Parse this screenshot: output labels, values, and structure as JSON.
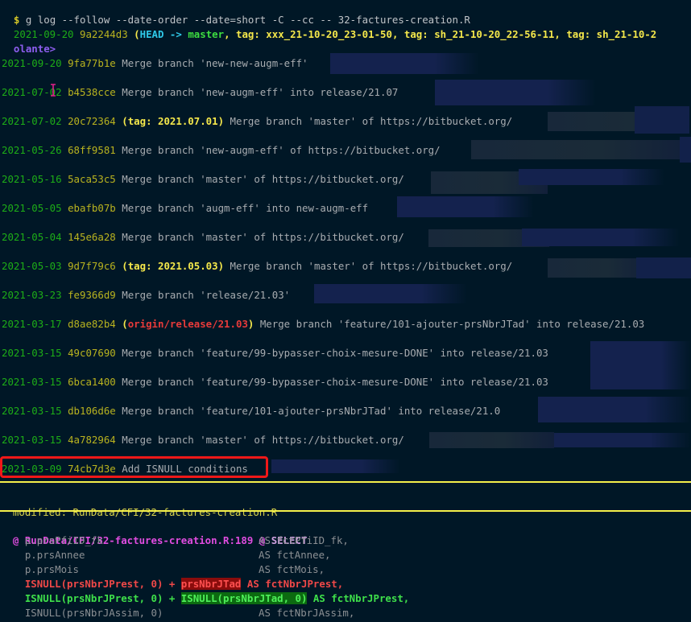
{
  "terminal": {
    "prompt_symbol": "$",
    "command": " g log --follow --date-order --date=short -C --cc -- 32-factures-creation.R",
    "head_commit": {
      "date": "2021-09-20",
      "hash": "9a2244d3",
      "open_paren": "(",
      "head_label": "HEAD -> ",
      "branch": "master",
      "sep1": ", ",
      "tag1": "tag: xxx_21-10-20_23-01-50",
      "sep2": ", ",
      "tag2": "tag: sh_21-10-20_22-56-11",
      "sep3": ", ",
      "tag3": "tag: sh_21-10-2",
      "continuation": "olante>"
    },
    "commits": [
      {
        "date": "2021-09-20",
        "hash": "9fa77b1e",
        "refs": "",
        "message": "Merge branch 'new-new-augm-eff'"
      },
      {
        "date": "2021-07-02",
        "hash": "b4538cce",
        "refs": "",
        "message": "Merge branch 'new-augm-eff' into release/21.07"
      },
      {
        "date": "2021-07-02",
        "hash": "20c72364",
        "refs": "tag: 2021.07.01",
        "ref_type": "tag",
        "message": "Merge branch 'master' of https://bitbucket.org/"
      },
      {
        "date": "2021-05-26",
        "hash": "68ff9581",
        "refs": "",
        "message": "Merge branch 'new-augm-eff' of https://bitbucket.org/"
      },
      {
        "date": "2021-05-16",
        "hash": "5aca53c5",
        "refs": "",
        "message": "Merge branch 'master' of https://bitbucket.org/"
      },
      {
        "date": "2021-05-05",
        "hash": "ebafb07b",
        "refs": "",
        "message": "Merge branch 'augm-eff' into new-augm-eff"
      },
      {
        "date": "2021-05-04",
        "hash": "145e6a28",
        "refs": "",
        "message": "Merge branch 'master' of https://bitbucket.org/"
      },
      {
        "date": "2021-05-03",
        "hash": "9d7f79c6",
        "refs": "tag: 2021.05.03",
        "ref_type": "tag",
        "message": "Merge branch 'master' of https://bitbucket.org/"
      },
      {
        "date": "2021-03-23",
        "hash": "fe9366d9",
        "refs": "",
        "message": "Merge branch 'release/21.03'"
      },
      {
        "date": "2021-03-17",
        "hash": "d8ae82b4",
        "refs": "origin/release/21.03",
        "ref_type": "origin",
        "message": "Merge branch 'feature/101-ajouter-prsNbrJTad' into release/21.03"
      },
      {
        "date": "2021-03-15",
        "hash": "49c07690",
        "refs": "",
        "message": "Merge branch 'feature/99-bypasser-choix-mesure-DONE' into release/21.03"
      },
      {
        "date": "2021-03-15",
        "hash": "6bca1400",
        "refs": "",
        "message": "Merge branch 'feature/99-bypasser-choix-mesure-DONE' into release/21.03"
      },
      {
        "date": "2021-03-15",
        "hash": "db106d6e",
        "refs": "",
        "message": "Merge branch 'feature/101-ajouter-prsNbrJTad' into release/21.0"
      },
      {
        "date": "2021-03-15",
        "hash": "4a782964",
        "refs": "",
        "message": "Merge branch 'master' of https://bitbucket.org/"
      },
      {
        "date": "2021-03-09",
        "hash": "74cb7d3e",
        "refs": "",
        "message": "Add ISNULL conditions",
        "highlighted": true
      }
    ],
    "diff": {
      "modified_label": "modified: RunData/CFI/32-factures-creation.R",
      "hunk_header": "@ RunData/CFI/32-factures-creation.R:189 @",
      "hunk_context": " SELECT",
      "lines": [
        {
          "type": "ctx",
          "left": "    p.prsPfiID_fk",
          "right": "AS fctPfiID_fk,"
        },
        {
          "type": "ctx",
          "left": "    p.prsAnnee",
          "right": "AS fctAnnee,"
        },
        {
          "type": "ctx",
          "left": "    p.prsMois",
          "right": "AS fctMois,"
        },
        {
          "type": "del",
          "prefix": "    ISNULL(prsNbrJPrest, 0) + ",
          "highlight": "prsNbrJTad",
          "suffix": " AS fctNbrJPrest,"
        },
        {
          "type": "add",
          "prefix": "    ISNULL(prsNbrJPrest, 0) + ",
          "highlight": "ISNULL(prsNbrJTad, 0)",
          "suffix": " AS fctNbrJPrest,"
        },
        {
          "type": "ctx",
          "left": "    ISNULL(prsNbrJAssim, 0)",
          "right": "AS fctNbrJAssim,"
        }
      ]
    }
  }
}
